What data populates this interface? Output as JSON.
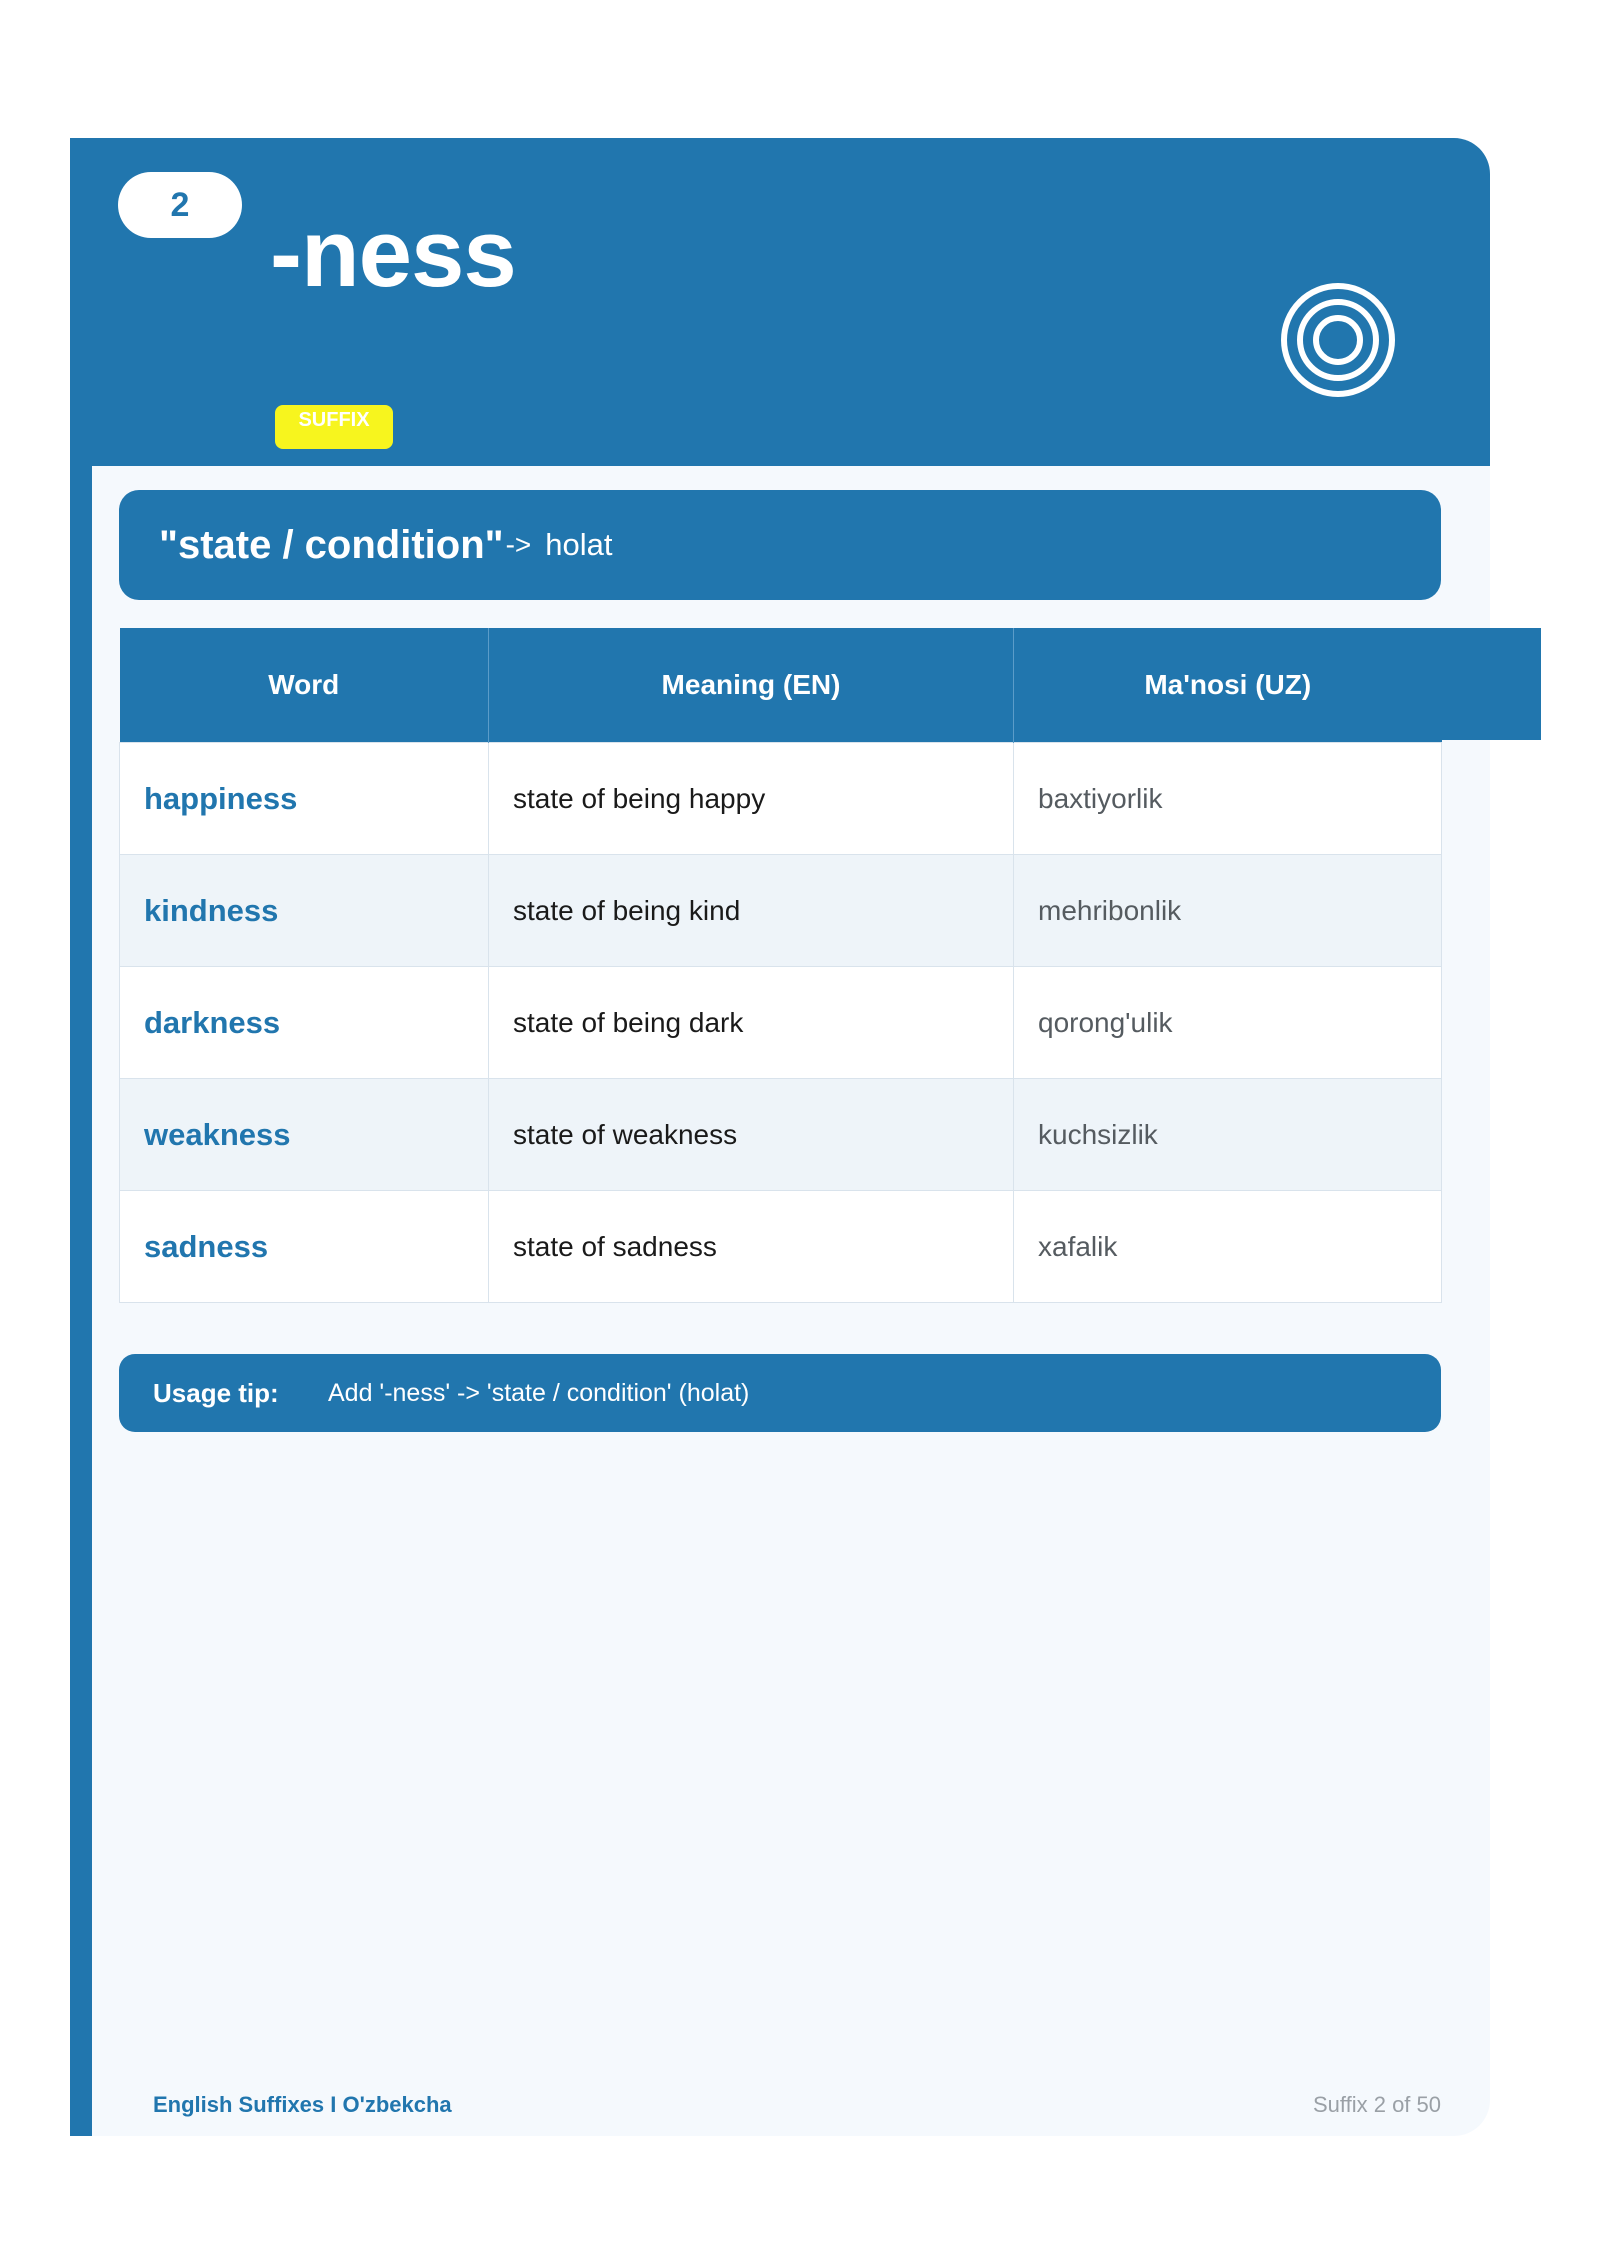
{
  "header": {
    "number": "2",
    "suffix": "-ness",
    "badge": "SUFFIX",
    "icon": "target-icon"
  },
  "meaning": {
    "english": "\"state / condition\"",
    "arrow": "->",
    "uzbek": "holat"
  },
  "table": {
    "columns": [
      "Word",
      "Meaning (EN)",
      "Ma'nosi (UZ)"
    ],
    "rows": [
      {
        "word": "happiness",
        "meaning_en": "state of being happy",
        "meaning_uz": "baxtiyorlik"
      },
      {
        "word": "kindness",
        "meaning_en": "state of being kind",
        "meaning_uz": "mehribonlik"
      },
      {
        "word": "darkness",
        "meaning_en": "state of being dark",
        "meaning_uz": "qorong'ulik"
      },
      {
        "word": "weakness",
        "meaning_en": "state of weakness",
        "meaning_uz": "kuchsizlik"
      },
      {
        "word": "sadness",
        "meaning_en": "state of sadness",
        "meaning_uz": "xafalik"
      }
    ]
  },
  "tip": {
    "label": "Usage tip:",
    "text": "Add '-ness' -> 'state / condition' (holat)"
  },
  "footer": {
    "left": "English Suffixes I O'zbekcha",
    "right": "Suffix 2 of 50"
  },
  "colors": {
    "primary": "#2176ae",
    "badge": "#f7f51e",
    "card_bg": "#f5f9fd",
    "row_alt": "#eef4f9"
  }
}
